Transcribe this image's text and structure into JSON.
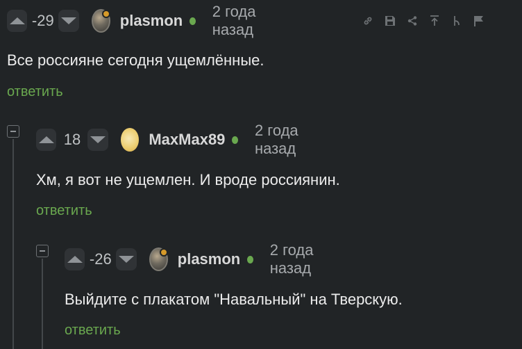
{
  "comments": [
    {
      "rating": "-29",
      "username": "plasmon",
      "time": "2 года назад",
      "text": "Все россияне сегодня ущемлённые.",
      "reply_label": "ответить"
    },
    {
      "rating": "18",
      "username": "MaxMax89",
      "time": "2 года назад",
      "text": "Хм, я вот не ущемлен. И вроде россиянин.",
      "reply_label": "ответить"
    },
    {
      "rating": "-26",
      "username": "plasmon",
      "time": "2 года назад",
      "text": "Выйдите с плакатом \"Навальный\" на Тверскую.",
      "reply_label": "ответить"
    }
  ],
  "toolbar_icons": [
    "link-icon",
    "save-icon",
    "share-icon",
    "scroll-top-icon",
    "branch-icon",
    "flag-icon"
  ],
  "colors": {
    "background": "#212426",
    "accent_green": "#6aa84f",
    "vote_button": "#303336",
    "avatar_badge": "#d69a2a"
  }
}
